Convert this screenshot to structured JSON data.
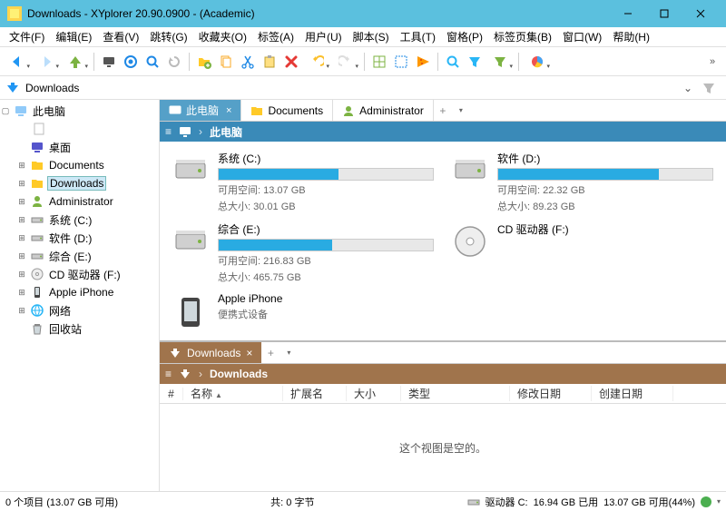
{
  "window": {
    "title": "Downloads - XYplorer 20.90.0900 - (Academic)"
  },
  "menus": [
    "文件(F)",
    "编辑(E)",
    "查看(V)",
    "跳转(G)",
    "收藏夹(O)",
    "标签(A)",
    "用户(U)",
    "脚本(S)",
    "工具(T)",
    "窗格(P)",
    "标签页集(B)",
    "窗口(W)",
    "帮助(H)"
  ],
  "address": {
    "label": "Downloads"
  },
  "tree": {
    "root": "此电脑",
    "items": [
      {
        "label": "桌面",
        "icon": "desktop"
      },
      {
        "label": "Documents",
        "icon": "folder"
      },
      {
        "label": "Downloads",
        "icon": "folder",
        "selected": true
      },
      {
        "label": "Administrator",
        "icon": "user"
      },
      {
        "label": "系统 (C:)",
        "icon": "drive"
      },
      {
        "label": "软件 (D:)",
        "icon": "drive"
      },
      {
        "label": "综合 (E:)",
        "icon": "drive"
      },
      {
        "label": "CD 驱动器 (F:)",
        "icon": "cd"
      },
      {
        "label": "Apple iPhone",
        "icon": "phone"
      },
      {
        "label": "网络",
        "icon": "network"
      },
      {
        "label": "回收站",
        "icon": "recycle"
      }
    ]
  },
  "upper": {
    "tabs": [
      {
        "label": "此电脑",
        "active": true
      },
      {
        "label": "Documents",
        "active": false
      },
      {
        "label": "Administrator",
        "active": false
      }
    ],
    "breadcrumb": "此电脑",
    "drives": [
      {
        "name": "系统 (C:)",
        "free_label": "可用空间:",
        "free": "13.07 GB",
        "total_label": "总大小:",
        "total": "30.01 GB",
        "fill": 56
      },
      {
        "name": "软件 (D:)",
        "free_label": "可用空间:",
        "free": "22.32 GB",
        "total_label": "总大小:",
        "total": "89.23 GB",
        "fill": 75
      },
      {
        "name": "综合 (E:)",
        "free_label": "可用空间:",
        "free": "216.83 GB",
        "total_label": "总大小:",
        "total": "465.75 GB",
        "fill": 53
      },
      {
        "name": "CD 驱动器 (F:)",
        "simple": true
      },
      {
        "name": "Apple iPhone",
        "sub": "便携式设备",
        "simple": true
      }
    ]
  },
  "lower": {
    "tab": "Downloads",
    "breadcrumb": "Downloads",
    "columns": {
      "num": "#",
      "name": "名称",
      "ext": "扩展名",
      "size": "大小",
      "type": "类型",
      "mod": "修改日期",
      "create": "创建日期"
    },
    "empty": "这个视图是空的。"
  },
  "status": {
    "items": "0 个项目 (13.07 GB 可用)",
    "bytes": "共: 0 字节",
    "drive_label": "驱动器 C:",
    "used": "16.94 GB 已用",
    "free": "13.07 GB 可用(44%)"
  }
}
